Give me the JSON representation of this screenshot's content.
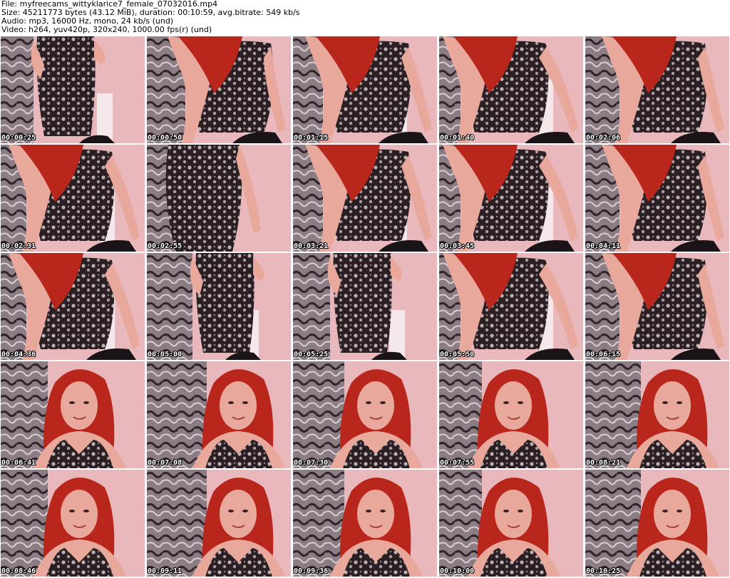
{
  "header": {
    "file": "File: myfreecams_wittyklarice7_female_07032016.mp4",
    "size": "Size: 45211773 bytes (43.12 MiB), duration: 00:10:59, avg.bitrate: 549 kb/s",
    "audio": "Audio: mp3, 16000 Hz, mono, 24 kb/s (und)",
    "video": "Video: h264, yuv420p, 320x240, 1000.00 fps(r) (und)"
  },
  "thumbnails": [
    {
      "timestamp": "00:00:25",
      "scene": "dress-standing"
    },
    {
      "timestamp": "00:00:50",
      "scene": "leaning"
    },
    {
      "timestamp": "00:01:15",
      "scene": "leaning"
    },
    {
      "timestamp": "00:01:40",
      "scene": "leaning"
    },
    {
      "timestamp": "00:02:06",
      "scene": "leaning"
    },
    {
      "timestamp": "00:02:31",
      "scene": "leaning"
    },
    {
      "timestamp": "00:02:55",
      "scene": "dress-closeup"
    },
    {
      "timestamp": "00:03:21",
      "scene": "leaning"
    },
    {
      "timestamp": "00:03:45",
      "scene": "leaning"
    },
    {
      "timestamp": "00:04:11",
      "scene": "leaning"
    },
    {
      "timestamp": "00:04:36",
      "scene": "leaning"
    },
    {
      "timestamp": "00:05:00",
      "scene": "dress-standing"
    },
    {
      "timestamp": "00:05:25",
      "scene": "dress-standing"
    },
    {
      "timestamp": "00:05:50",
      "scene": "leaning"
    },
    {
      "timestamp": "00:06:15",
      "scene": "leaning"
    },
    {
      "timestamp": "00:06:41",
      "scene": "face"
    },
    {
      "timestamp": "00:07:08",
      "scene": "face"
    },
    {
      "timestamp": "00:07:30",
      "scene": "face"
    },
    {
      "timestamp": "00:07:55",
      "scene": "face"
    },
    {
      "timestamp": "00:08:21",
      "scene": "face"
    },
    {
      "timestamp": "00:08:46",
      "scene": "face"
    },
    {
      "timestamp": "00:09:11",
      "scene": "face"
    },
    {
      "timestamp": "00:09:36",
      "scene": "face"
    },
    {
      "timestamp": "00:10:00",
      "scene": "face"
    },
    {
      "timestamp": "00:10:25",
      "scene": "face"
    }
  ],
  "colors": {
    "wall": "#e8b8bc",
    "wall_dark": "#6a5a62",
    "hair": "#b8261c",
    "skin": "#e9a89c",
    "dress": "#2a2024",
    "lace": "#d8c8cc",
    "chair": "#1a1418",
    "timestamp_text": "#ffffff"
  }
}
